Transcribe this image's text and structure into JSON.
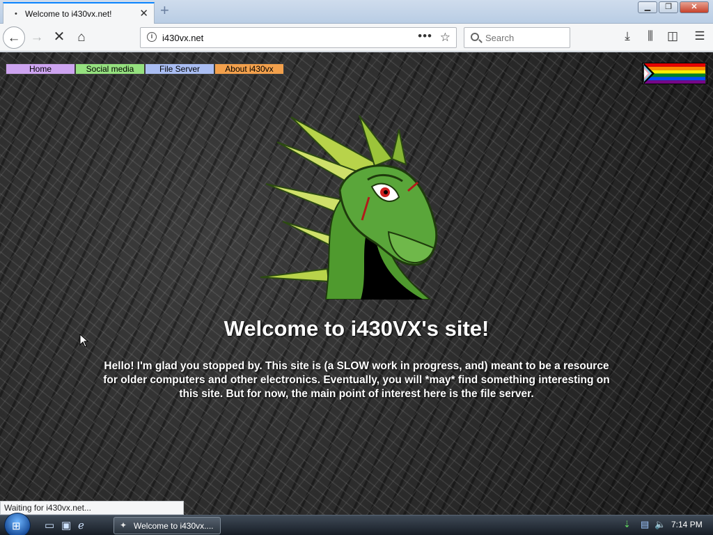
{
  "browser": {
    "tab_title": "Welcome to i430vx.net!",
    "url": "i430vx.net",
    "search_placeholder": "Search",
    "status_text": "Waiting for i430vx.net..."
  },
  "page": {
    "menu": [
      {
        "label": "Home",
        "color": "#cda4f0"
      },
      {
        "label": "Social media",
        "color": "#95e07f"
      },
      {
        "label": "File Server",
        "color": "#a9bdf2"
      },
      {
        "label": "About i430vx",
        "color": "#f2a04c"
      }
    ],
    "heading": "Welcome to i430VX's site!",
    "intro": "Hello! I'm glad you stopped by. This site is (a SLOW work in progress, and) meant to be a resource for older computers and other electronics. Eventually, you will *may* find something interesting on this site. But for now, the main point of interest here is the file server."
  },
  "taskbar": {
    "task_label": "Welcome to i430vx....",
    "clock": "7:14 PM"
  }
}
